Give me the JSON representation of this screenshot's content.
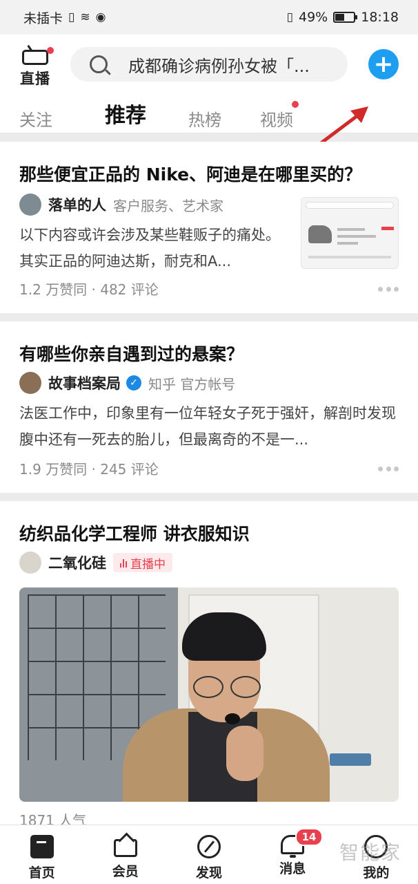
{
  "status_bar": {
    "carrier": "未插卡",
    "battery": "49%",
    "battery_level": 0.49,
    "time": "18:18"
  },
  "header": {
    "live_label": "直播",
    "search_placeholder": "成都确诊病例孙女被「...",
    "add_icon": "plus-icon",
    "tabs": [
      {
        "label": "关注",
        "active": false
      },
      {
        "label": "推荐",
        "active": true
      },
      {
        "label": "热榜",
        "active": false
      },
      {
        "label": "视频",
        "active": false,
        "dot": true
      }
    ],
    "accent_color": "#1e9ef0",
    "annotation_color": "#d02a2a"
  },
  "feed": [
    {
      "title": "那些便宜正品的 Nike、阿迪是在哪里买的？",
      "author": "落单的人",
      "author_desc": "客户服务、艺术家",
      "excerpt": "以下内容或许会涉及某些鞋贩子的痛处。其实正品的阿迪达斯，耐克和A...",
      "stats": "1.2 万赞同 · 482 评论"
    },
    {
      "title": "有哪些你亲自遇到过的悬案？",
      "author": "故事档案局",
      "author_desc": "知乎 官方帐号",
      "verified": true,
      "excerpt": "法医工作中，印象里有一位年轻女子死于强奸，解剖时发现腹中还有一死去的胎儿，但最离奇的不是一...",
      "stats": "1.9 万赞同 · 245 评论"
    },
    {
      "title": "纺织品化学工程师  讲衣服知识",
      "author": "二氧化硅",
      "live_badge": "直播中",
      "stats": "1871 人气"
    }
  ],
  "bottom_nav": [
    {
      "label": "首页",
      "icon": "home-icon"
    },
    {
      "label": "会员",
      "icon": "vip-icon"
    },
    {
      "label": "发现",
      "icon": "discover-icon"
    },
    {
      "label": "消息",
      "icon": "bell-icon",
      "badge": "14"
    },
    {
      "label": "我的",
      "icon": "profile-icon"
    }
  ],
  "watermark": "智能家"
}
